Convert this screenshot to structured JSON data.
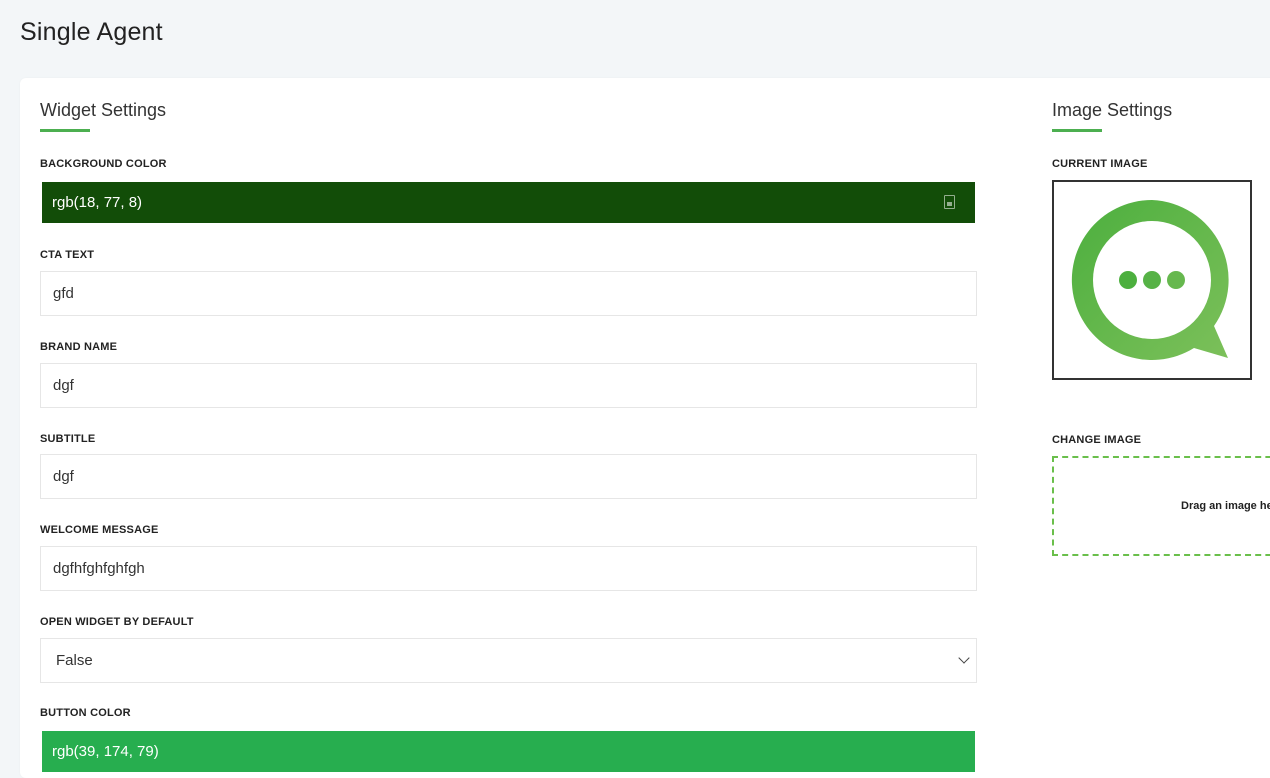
{
  "page": {
    "title": "Single Agent"
  },
  "widget": {
    "heading": "Widget Settings",
    "background_color": {
      "label": "BACKGROUND COLOR",
      "value": "rgb(18, 77, 8)",
      "swatch": "#124d08"
    },
    "cta_text": {
      "label": "CTA TEXT",
      "value": "gfd"
    },
    "brand_name": {
      "label": "BRAND NAME",
      "value": "dgf"
    },
    "subtitle": {
      "label": "SUBTITLE",
      "value": "dgf"
    },
    "welcome_message": {
      "label": "WELCOME MESSAGE",
      "value": "dgfhfghfghfgh"
    },
    "open_by_default": {
      "label": "OPEN WIDGET BY DEFAULT",
      "value": "False"
    },
    "button_color": {
      "label": "BUTTON COLOR",
      "value": "rgb(39, 174, 79)",
      "swatch": "#27ae4f"
    }
  },
  "image": {
    "heading": "Image Settings",
    "current_label": "CURRENT IMAGE",
    "current_icon": "chat-bubble-icon",
    "change_label": "CHANGE IMAGE",
    "dropzone_text": "Drag an image here"
  },
  "colors": {
    "accent": "#4caf50",
    "bubble_light": "#7cc05a",
    "bubble_dark": "#4caf3e"
  }
}
